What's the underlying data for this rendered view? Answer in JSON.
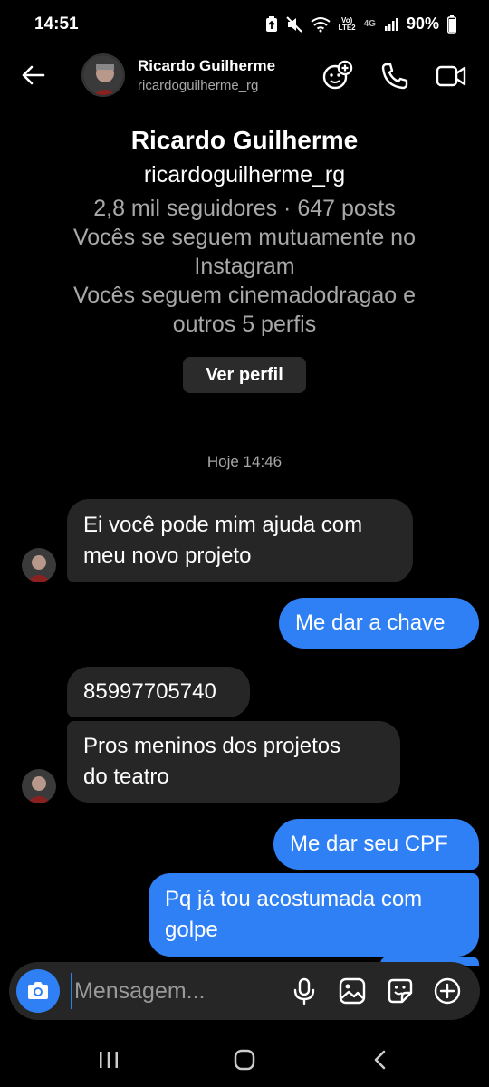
{
  "status": {
    "time": "14:51",
    "volte_top": "Vo)",
    "volte_bottom": "LTE2",
    "network": "4G",
    "battery": "90%"
  },
  "header": {
    "name": "Ricardo Guilherme",
    "username": "ricardoguilherme_rg"
  },
  "profile": {
    "name": "Ricardo Guilherme",
    "username": "ricardoguilherme_rg",
    "stats": "2,8 mil seguidores · 647 posts",
    "mutual_line1": "Vocês se seguem mutuamente no",
    "mutual_line2": "Instagram",
    "follow_line1": "Vocês seguem cinemadodragao e",
    "follow_line2": "outros 5 perfis",
    "view_profile": "Ver perfil"
  },
  "timestamp": "Hoje 14:46",
  "messages": [
    {
      "from": "them",
      "line1": "Ei você pode mim ajuda com",
      "line2": "meu novo projeto"
    },
    {
      "from": "me",
      "line1": "Me dar a chave"
    },
    {
      "from": "them",
      "line1": "85997705740"
    },
    {
      "from": "them",
      "line1": "Pros meninos dos projetos",
      "line2": "do teatro"
    },
    {
      "from": "me",
      "line1": "Me dar seu CPF"
    },
    {
      "from": "me",
      "line1": "Pq já tou acostumada com",
      "line2": "golpe"
    }
  ],
  "composer": {
    "placeholder": "Mensagem..."
  },
  "colors": {
    "accent": "#2f80f5",
    "incoming_bubble": "#262626",
    "background": "#000000"
  },
  "icons": {
    "back": "arrow-left-icon",
    "group": "add-people-icon",
    "call": "phone-icon",
    "video": "video-camera-icon",
    "camera": "camera-icon",
    "mic": "microphone-icon",
    "gallery": "image-icon",
    "sticker": "sticker-icon",
    "more": "plus-circle-icon"
  }
}
